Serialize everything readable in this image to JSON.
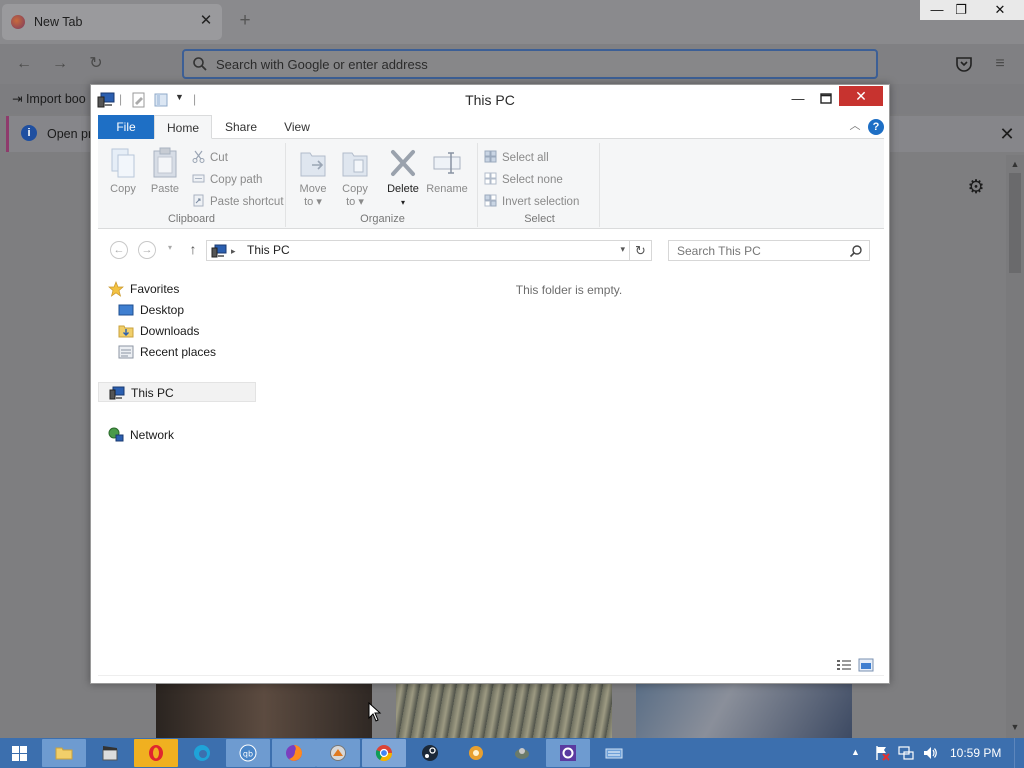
{
  "browser": {
    "tab_title": "New Tab",
    "tab_close": "✕",
    "new_tab": "+",
    "window_min": "—",
    "window_max": "❐",
    "window_close": "✕",
    "url_placeholder": "Search with Google or enter address",
    "bookmark_import": "Import boo",
    "info_text": "Open pre",
    "info_close": "✕",
    "settings": "⚙"
  },
  "explorer": {
    "title": "This PC",
    "min": "—",
    "close": "✕",
    "tabs": {
      "file": "File",
      "home": "Home",
      "share": "Share",
      "view": "View"
    },
    "help": "?",
    "clipboard": {
      "label": "Clipboard",
      "copy": "Copy",
      "paste": "Paste",
      "cut": "Cut",
      "copy_path": "Copy path",
      "paste_shortcut": "Paste shortcut"
    },
    "organize": {
      "label": "Organize",
      "move_to_1": "Move",
      "move_to_2": "to ▾",
      "copy_to_1": "Copy",
      "copy_to_2": "to ▾",
      "delete": "Delete",
      "delete_arrow": "▾",
      "rename": "Rename"
    },
    "select": {
      "label": "Select",
      "select_all": "Select all",
      "select_none": "Select none",
      "invert": "Invert selection"
    },
    "address": {
      "back": "←",
      "forward": "→",
      "recent": "▾",
      "up": "↑",
      "path": "This PC",
      "separator": "▸",
      "dropdown": "▾",
      "refresh": "↻",
      "search_placeholder": "Search This PC"
    },
    "nav": {
      "favorites": "Favorites",
      "desktop": "Desktop",
      "downloads": "Downloads",
      "recent_places": "Recent places",
      "this_pc": "This PC",
      "network": "Network"
    },
    "empty_message": "This folder is empty."
  },
  "taskbar": {
    "clock": "10:59 PM",
    "tray_arrow": "▲"
  },
  "colors": {
    "accent": "#1e6fc5",
    "close_red": "#c7332f",
    "taskbar": "#3c6fae"
  }
}
